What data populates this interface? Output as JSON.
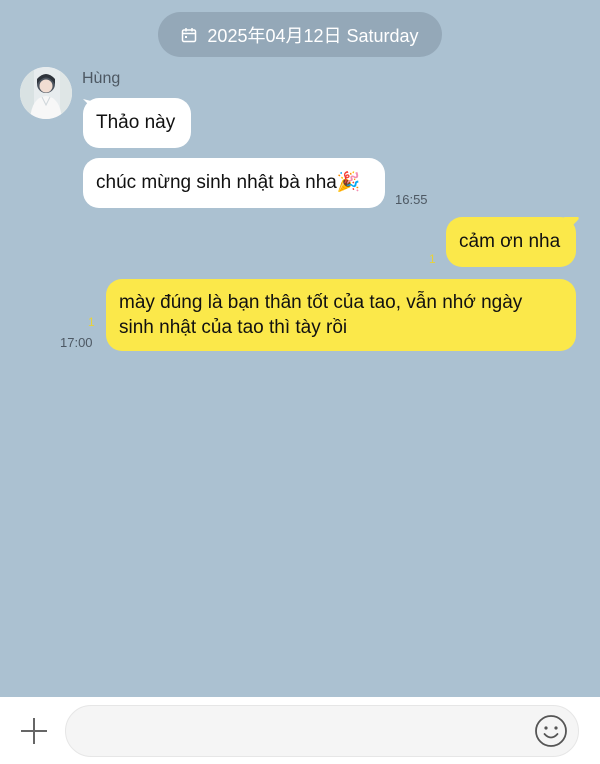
{
  "date_pill": {
    "text": "2025年04月12日 Saturday",
    "icon": "calendar-icon"
  },
  "contact": {
    "name": "Hùng",
    "avatar": "avatar-image"
  },
  "messages": [
    {
      "sender": "Hùng",
      "direction": "incoming",
      "text": "Thảo này"
    },
    {
      "sender": "Hùng",
      "direction": "incoming",
      "text": "chúc mừng sinh nhật bà nha🎉",
      "time": "16:55"
    },
    {
      "sender": "me",
      "direction": "outgoing",
      "text": "cảm ơn nha",
      "unread": "1"
    },
    {
      "sender": "me",
      "direction": "outgoing",
      "lines": [
        "mày đúng là bạn thân tốt của tao, vẫn nhớ ngày",
        "sinh nhật của tao thì tày rồi"
      ],
      "unread": "1",
      "time": "17:00"
    }
  ],
  "input_bar": {
    "plus_icon": "plus-icon",
    "emoji_icon": "emoji-icon",
    "value": ""
  },
  "colors": {
    "background": "#abc1d1",
    "incoming_bubble": "#ffffff",
    "outgoing_bubble": "#fbe84a",
    "date_pill": "#94a8b8",
    "unread": "#e8d23a"
  }
}
